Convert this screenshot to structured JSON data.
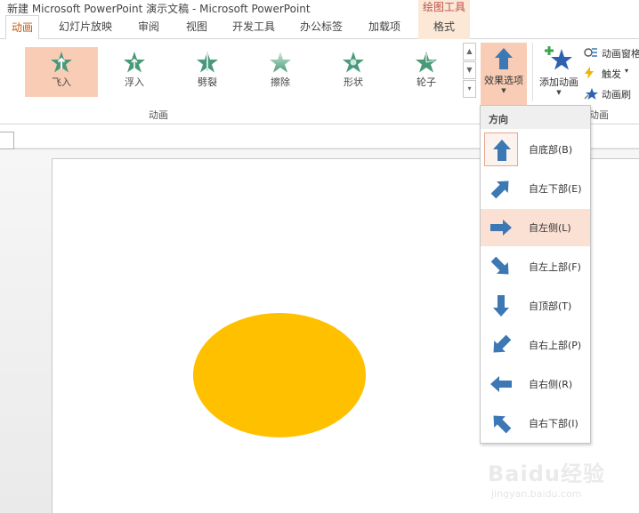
{
  "window": {
    "title": "新建 Microsoft PowerPoint 演示文稿 - Microsoft PowerPoint",
    "contextual_title": "绘图工具"
  },
  "tabs": [
    {
      "label": "动画",
      "active": true
    },
    {
      "label": "幻灯片放映"
    },
    {
      "label": "审阅"
    },
    {
      "label": "视图"
    },
    {
      "label": "开发工具"
    },
    {
      "label": "办公标签"
    },
    {
      "label": "加载项"
    },
    {
      "label": "格式",
      "contextual": true
    }
  ],
  "ribbon": {
    "gallery": [
      {
        "label": "飞入",
        "icon": "fly-in-star-icon",
        "selected": true
      },
      {
        "label": "浮入",
        "icon": "float-in-star-icon"
      },
      {
        "label": "劈裂",
        "icon": "split-star-icon"
      },
      {
        "label": "擦除",
        "icon": "wipe-star-icon"
      },
      {
        "label": "形状",
        "icon": "shape-star-icon"
      },
      {
        "label": "轮子",
        "icon": "wheel-star-icon"
      }
    ],
    "group_animation_label": "动画",
    "effect_options_label": "效果选项",
    "add_animation_label": "添加动画",
    "side_items": [
      {
        "label": "动画窗格",
        "icon": "animation-pane-icon"
      },
      {
        "label": "触发",
        "icon": "trigger-icon",
        "has_caret": true
      },
      {
        "label": "动画刷",
        "icon": "animation-painter-icon"
      }
    ],
    "group_advanced_label": "动画",
    "colors": {
      "selected": "#f9cdb5",
      "star_green": "#4a9a7a",
      "arrow_blue": "#3c78b4"
    }
  },
  "dropdown": {
    "title": "方向",
    "items": [
      {
        "label": "自底部(B)",
        "icon": "arrow-up-icon",
        "selected": true
      },
      {
        "label": "自左下部(E)",
        "icon": "arrow-up-right-icon"
      },
      {
        "label": "自左侧(L)",
        "icon": "arrow-right-icon",
        "hover": true
      },
      {
        "label": "自左上部(F)",
        "icon": "arrow-down-right-icon"
      },
      {
        "label": "自顶部(T)",
        "icon": "arrow-down-icon"
      },
      {
        "label": "自右上部(P)",
        "icon": "arrow-down-left-icon"
      },
      {
        "label": "自右侧(R)",
        "icon": "arrow-left-icon"
      },
      {
        "label": "自右下部(I)",
        "icon": "arrow-up-left-icon"
      }
    ]
  },
  "slide": {
    "shape": "ellipse",
    "fill": "#ffc000"
  },
  "watermark": {
    "brand": "Baidu经验",
    "url": "jingyan.baidu.com"
  }
}
